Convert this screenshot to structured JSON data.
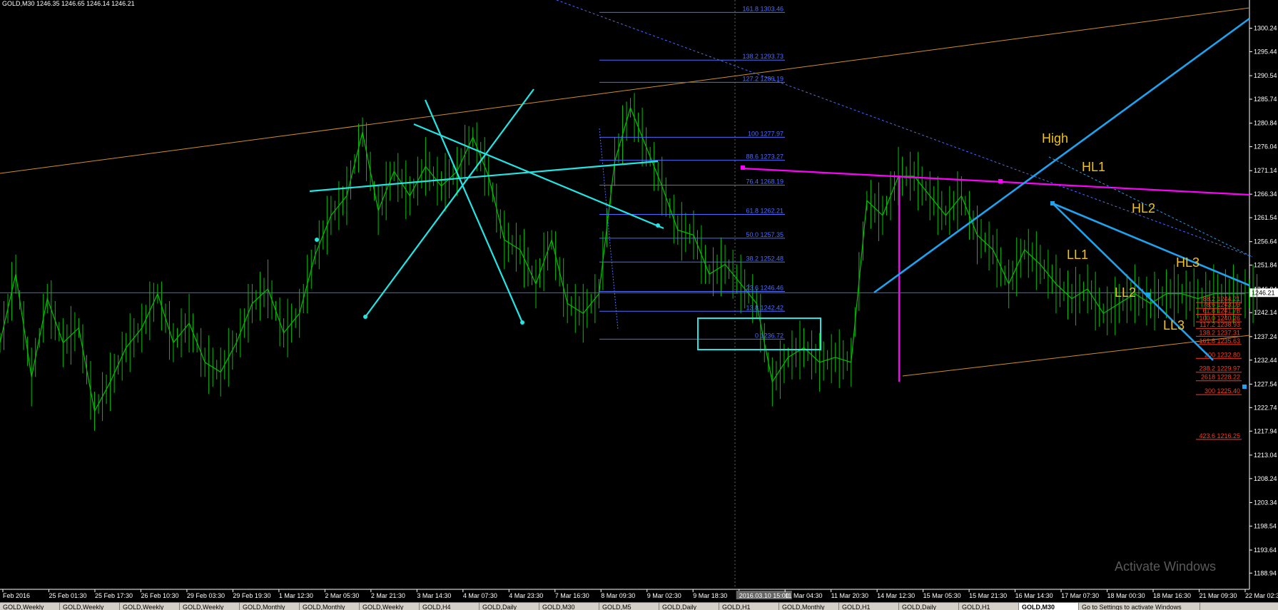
{
  "header": {
    "text": "GOLD,M30  1246.35 1246.65 1246.14 1246.21"
  },
  "colors": {
    "background": "#000000",
    "candles": "#00c000",
    "fib": "#4a6cff",
    "fib_ext": "#ff3b1a",
    "magenta": "#ff00ff",
    "cyan": "#22e6e6",
    "blue": "#1ea3f0",
    "orange": "#d09020",
    "label_gold": "#f2c21a"
  },
  "chart_data": {
    "type": "line",
    "symbol": "GOLD,M30",
    "ylim": [
      1186.5,
      1306.0
    ],
    "y_ticks": [
      "1300.24",
      "1295.44",
      "1290.54",
      "1285.74",
      "1280.84",
      "1276.04",
      "1271.14",
      "1266.34",
      "1261.54",
      "1256.64",
      "1251.84",
      "1246.94",
      "1242.14",
      "1237.24",
      "1232.44",
      "1227.54",
      "1222.74",
      "1217.94",
      "1213.04",
      "1208.24",
      "1203.34",
      "1198.54",
      "1193.64",
      "1188.94"
    ],
    "current_price_label": "1246.21",
    "x_ticks": [
      "Feb 2016",
      "25 Feb 01:30",
      "25 Feb 17:30",
      "26 Feb 10:30",
      "29 Feb 03:30",
      "29 Feb 19:30",
      "1 Mar 12:30",
      "2 Mar 05:30",
      "2 Mar 21:30",
      "3 Mar 14:30",
      "4 Mar 07:30",
      "4 Mar 23:30",
      "7 Mar 16:30",
      "8 Mar 09:30",
      "9 Mar 02:30",
      "9 Mar 18:30",
      "2016.03.10 15:00",
      "11 Mar 04:30",
      "11 Mar 20:30",
      "14 Mar 12:30",
      "15 Mar 05:30",
      "15 Mar 21:30",
      "16 Mar 14:30",
      "17 Mar 07:30",
      "18 Mar 00:30",
      "18 Mar 16:30",
      "21 Mar 09:30",
      "22 Mar 02:30"
    ],
    "series": [
      {
        "type": "line",
        "x": [
          0,
          1,
          2,
          3,
          4,
          5,
          6,
          7,
          8,
          9,
          10,
          11,
          12,
          13,
          14,
          15,
          16,
          17,
          18,
          19,
          20,
          21,
          22,
          23,
          24,
          25,
          26,
          27,
          28,
          29,
          30,
          31,
          32,
          33,
          34,
          35,
          36,
          37,
          38,
          39,
          40,
          41,
          42,
          43,
          44,
          45,
          46,
          47,
          48,
          49,
          50,
          51,
          52,
          53,
          54,
          55,
          56,
          57,
          58,
          59,
          60,
          61,
          62,
          63,
          64,
          65,
          66,
          67,
          68,
          69,
          70,
          71,
          72,
          73,
          74,
          75,
          76,
          77,
          78,
          79
        ],
        "values": [
          1236,
          1250,
          1229,
          1245,
          1236,
          1239,
          1222,
          1228,
          1235,
          1239,
          1246,
          1236,
          1240,
          1232,
          1230,
          1236,
          1244,
          1247,
          1238,
          1242,
          1254,
          1262,
          1266,
          1279,
          1263,
          1271,
          1266,
          1272,
          1268,
          1271,
          1278,
          1270,
          1257,
          1255,
          1248,
          1257,
          1244,
          1242,
          1246,
          1273,
          1284,
          1276,
          1268,
          1259,
          1258,
          1250,
          1252,
          1248,
          1244,
          1228,
          1233,
          1235,
          1232,
          1233,
          1232,
          1265,
          1262,
          1270,
          1270,
          1266,
          1262,
          1266,
          1258,
          1255,
          1248,
          1255,
          1252,
          1248,
          1245,
          1247,
          1242,
          1244,
          1246,
          1244,
          1246,
          1246,
          1245,
          1246,
          1246,
          1246
        ]
      }
    ],
    "fib_retracement": [
      {
        "label": "161.8 1303.46"
      },
      {
        "label": "138.2 1293.73"
      },
      {
        "label": "127.2 1289.19"
      },
      {
        "label": "100 1277.97"
      },
      {
        "label": "88.6 1273.27"
      },
      {
        "label": "76.4 1268.19"
      },
      {
        "label": "61.8 1262.21"
      },
      {
        "label": "50.0 1257.35"
      },
      {
        "label": "38.2 1252.48"
      },
      {
        "label": "23.6 1246.46"
      },
      {
        "label": "13.8 1242.42"
      },
      {
        "label": "0 1236.72"
      }
    ],
    "fib_extension": [
      {
        "label": "88.2 1244.21"
      },
      {
        "label": "78.6 1243.03"
      },
      {
        "label": "61.8 1241.78"
      },
      {
        "label": "100.0 1240.26"
      },
      {
        "label": "117.2 1238.93"
      },
      {
        "label": "138.2 1237.31"
      },
      {
        "label": "161.8 1235.63"
      },
      {
        "label": "200 1232.80"
      },
      {
        "label": "238.2 1229.97"
      },
      {
        "label": "2618 1228.22"
      },
      {
        "label": "300 1225.40"
      },
      {
        "label": "423.6 1216.25"
      }
    ],
    "annotations": [
      "High",
      "HL1",
      "HL2",
      "HL3",
      "LL1",
      "LL2",
      "LL3"
    ],
    "watermark": "Activate Windows"
  },
  "tabs": [
    "GOLD,Weekly",
    "GOLD,Weekly",
    "GOLD,Weekly",
    "GOLD,Weekly",
    "GOLD,Monthly",
    "GOLD,Monthly",
    "GOLD,Weekly",
    "GOLD,H4",
    "GOLD,Daily",
    "GOLD,M30",
    "GOLD,M5",
    "GOLD,Daily",
    "GOLD,H1",
    "GOLD,Monthly",
    "GOLD,H1",
    "GOLD,Daily",
    "GOLD,H1",
    "GOLD,M30",
    "Go to Settings to activate Windows"
  ]
}
